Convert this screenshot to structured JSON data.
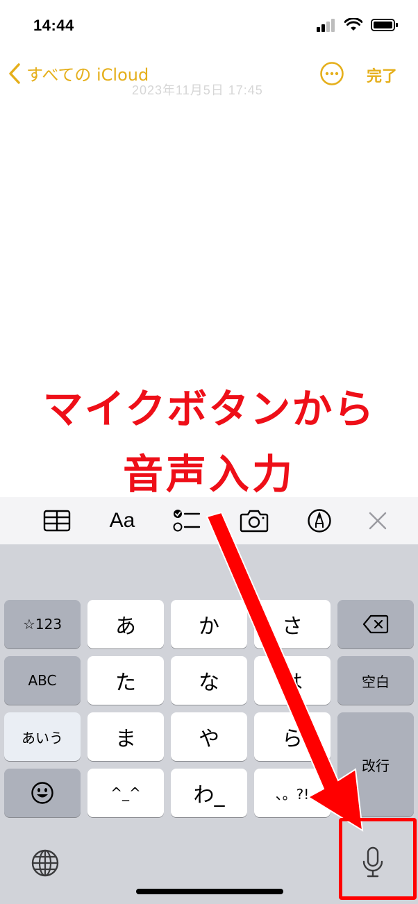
{
  "status_bar": {
    "time": "14:44"
  },
  "nav": {
    "back_label": "すべての iCloud",
    "done_label": "完了",
    "date_faint": "2023年11月5日 17:45"
  },
  "annotation": {
    "line1": "マイクボタンから",
    "line2": "音声入力"
  },
  "toolbar": {
    "text_style_label": "Aa"
  },
  "keyboard": {
    "rows": [
      [
        "☆123",
        "あ",
        "か",
        "さ"
      ],
      [
        "ABC",
        "た",
        "な",
        "は",
        "空白"
      ],
      [
        "あいう",
        "ま",
        "や",
        "ら",
        "改行"
      ],
      [
        "^_^",
        "わ_",
        "、。?!"
      ]
    ],
    "symbols_label": "☆123",
    "abc_label": "ABC",
    "kana_label": "あいう",
    "space_label": "空白",
    "return_label": "改行",
    "emoji_label": "^_^",
    "wa_label": "わ_",
    "punct_label": "、。?!"
  },
  "colors": {
    "accent": "#E5AF1B",
    "annotation_red": "#EE0F18",
    "keyboard_bg": "#D1D3D9"
  }
}
